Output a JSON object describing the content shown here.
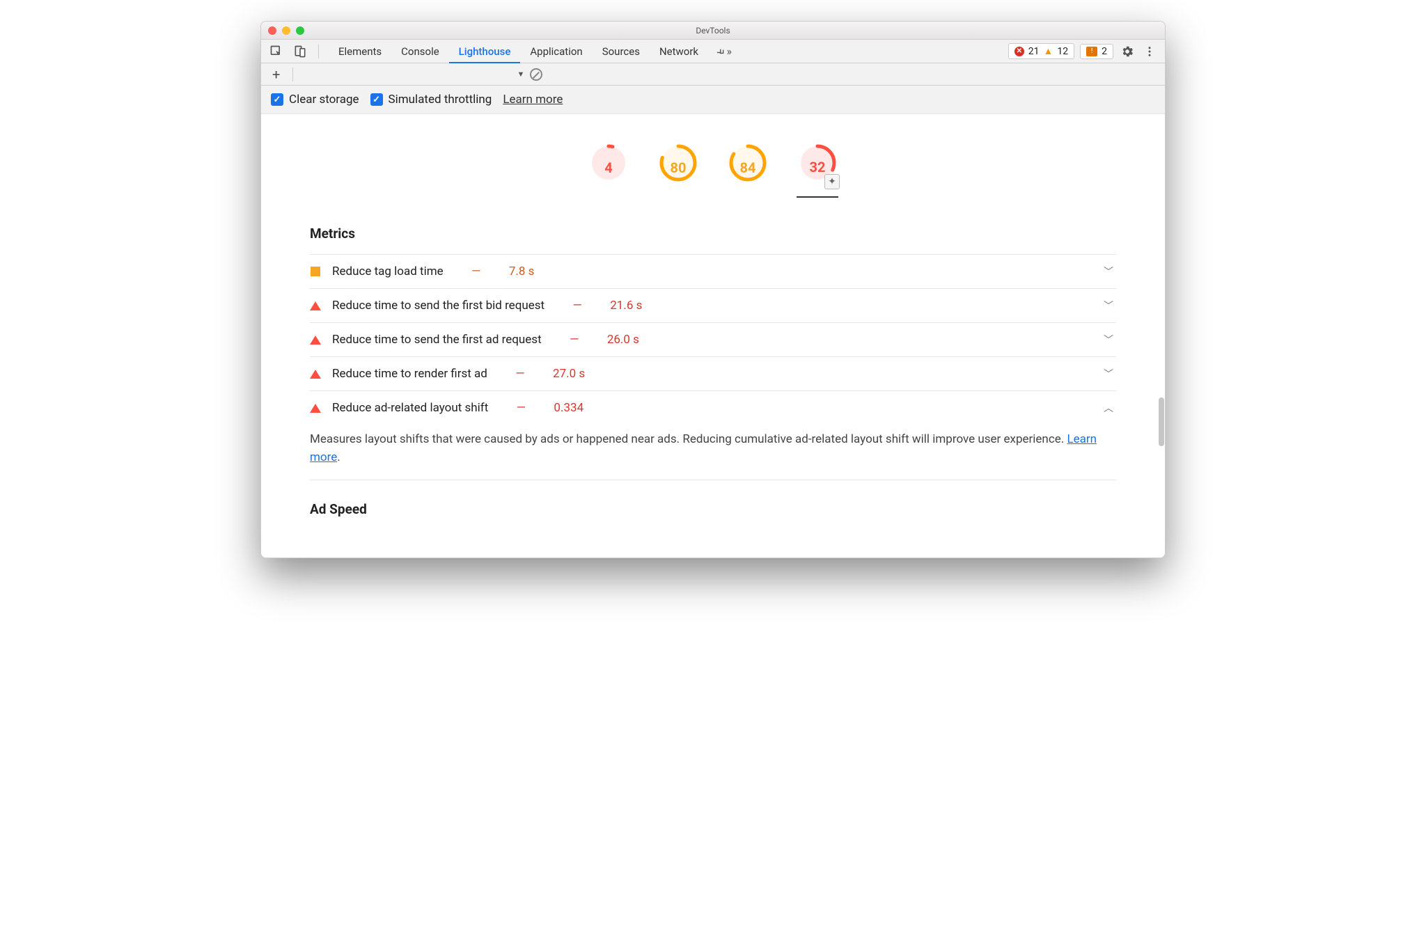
{
  "window": {
    "title": "DevTools"
  },
  "tabs": {
    "items": [
      "Elements",
      "Console",
      "Lighthouse",
      "Application",
      "Sources",
      "Network"
    ],
    "active": "Lighthouse"
  },
  "counts": {
    "errors": "21",
    "warnings": "12",
    "issues": "2"
  },
  "options": {
    "clear_storage": "Clear storage",
    "sim_throttle": "Simulated throttling",
    "learn_more": "Learn more"
  },
  "gauges": [
    {
      "score": "4",
      "color": "red",
      "pct": 4
    },
    {
      "score": "80",
      "color": "orange",
      "pct": 80
    },
    {
      "score": "84",
      "color": "orange",
      "pct": 84
    },
    {
      "score": "32",
      "color": "red",
      "pct": 32,
      "badge": true
    }
  ],
  "sections": {
    "metrics_title": "Metrics",
    "ad_speed_title": "Ad Speed"
  },
  "metrics": [
    {
      "icon": "square",
      "title": "Reduce tag load time",
      "value": "7.8 s",
      "state": "orange",
      "expanded": false
    },
    {
      "icon": "triangle",
      "title": "Reduce time to send the first bid request",
      "value": "21.6 s",
      "state": "red",
      "expanded": false
    },
    {
      "icon": "triangle",
      "title": "Reduce time to send the first ad request",
      "value": "26.0 s",
      "state": "red",
      "expanded": false
    },
    {
      "icon": "triangle",
      "title": "Reduce time to render first ad",
      "value": "27.0 s",
      "state": "red",
      "expanded": false
    },
    {
      "icon": "triangle",
      "title": "Reduce ad-related layout shift",
      "value": "0.334",
      "state": "red",
      "expanded": true,
      "desc": "Measures layout shifts that were caused by ads or happened near ads. Reducing cumulative ad-related layout shift will improve user experience. ",
      "desc_link": "Learn more"
    }
  ]
}
